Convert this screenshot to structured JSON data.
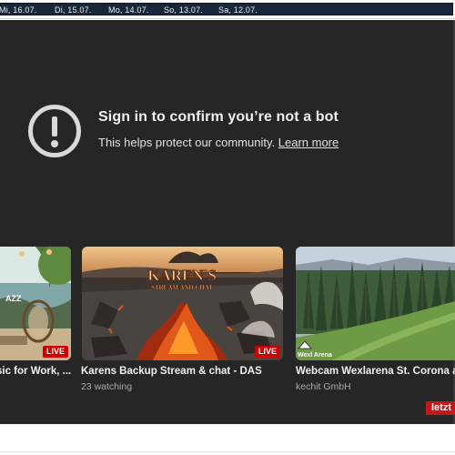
{
  "dates": [
    "Mi, 16.07.",
    "Di, 15.07.",
    "Mo, 14.07.",
    "So, 13.07.",
    "Sa, 12.07."
  ],
  "error": {
    "icon": "exclamation-circle-icon",
    "title": "Sign in to confirm you’re not a bot",
    "message": "This helps protect our community.",
    "link": "Learn more"
  },
  "cards": [
    {
      "title": "sic for Work, ...",
      "subtitle": "",
      "badge": "LIVE",
      "thumb_text": "AZZ"
    },
    {
      "title": "Karens Backup Stream & chat - DAS",
      "subtitle": "23 watching",
      "badge": "LIVE",
      "thumb_text": "KAREN'S",
      "thumb_subtext": "STREAM AND CHAT"
    },
    {
      "title": "Webcam Wexlarena St. Corona an",
      "subtitle": "kechit GmbH",
      "badge": "",
      "thumb_text": "Wexl Arena"
    }
  ],
  "next_label": "letzt",
  "colors": {
    "player_bg": "#262626",
    "live_red": "#cc0000",
    "date_bar": "#1a2639"
  }
}
